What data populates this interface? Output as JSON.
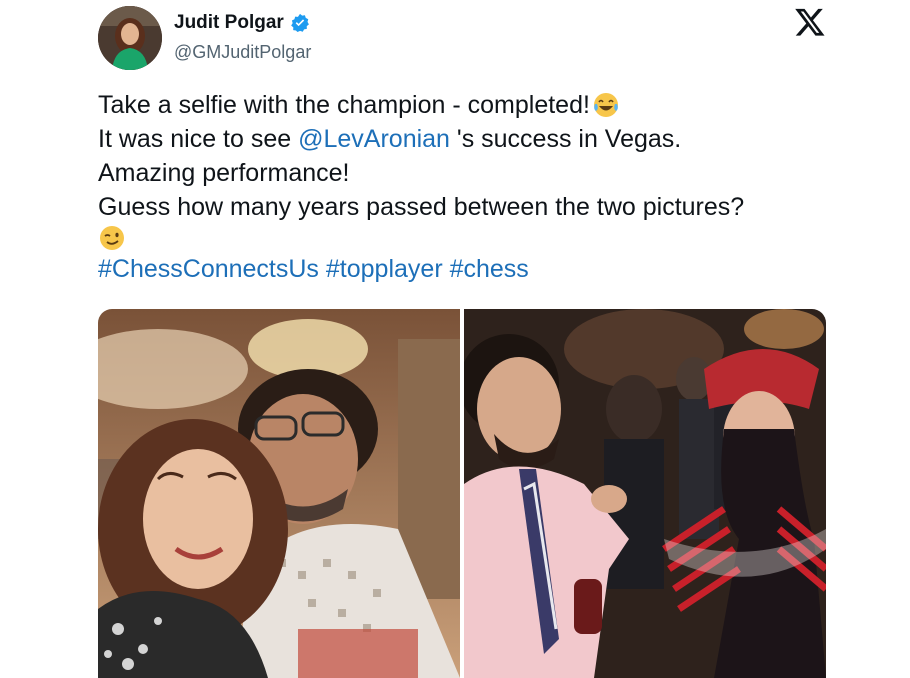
{
  "author": {
    "display_name": "Judit Polgar",
    "handle": "@GMJuditPolgar",
    "verified": true,
    "avatar_icon": "profile-photo"
  },
  "platform_icon": "x-logo-icon",
  "tweet": {
    "line1": "Take a selfie with the champion - completed!",
    "line1_emoji": "tears-of-joy-emoji",
    "line2_prefix": "It was nice to see ",
    "mention": "@LevAronian",
    "line2_suffix": " 's success in Vegas.",
    "line3": "Amazing performance!",
    "line4": "Guess how many years passed between the two pictures?",
    "line5_emoji": "winking-face-emoji",
    "hashtags": [
      "#ChessConnectsUs",
      "#topplayer",
      "#chess"
    ]
  },
  "colors": {
    "link": "#1d6fb8",
    "verified": "#1d9bf0",
    "handle": "#536471"
  },
  "media": {
    "left_photo": "selfie-photo",
    "right_photo": "old-photo"
  }
}
